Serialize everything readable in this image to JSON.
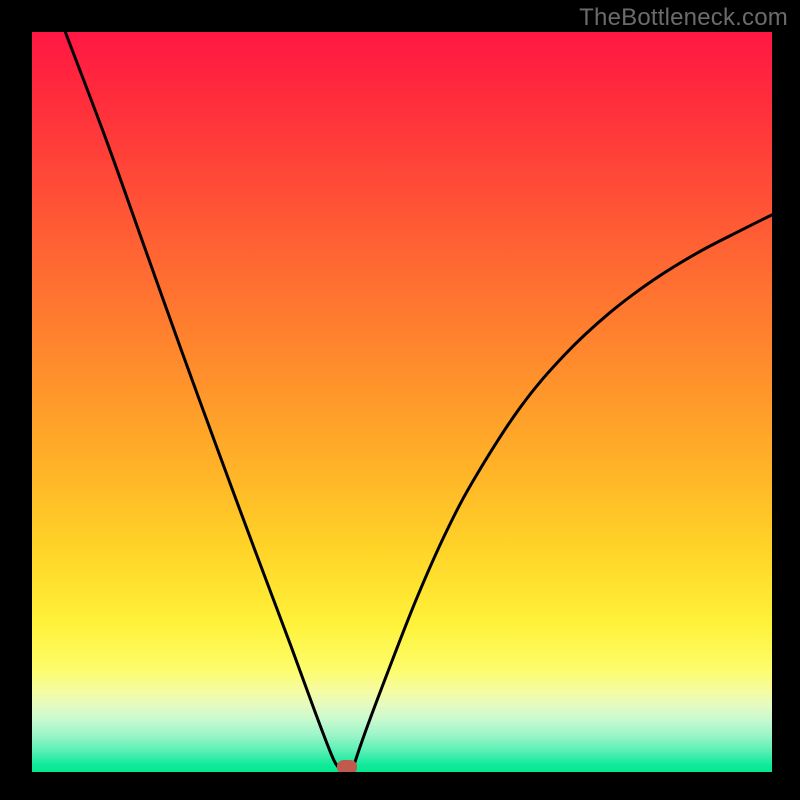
{
  "watermark": "TheBottleneck.com",
  "colors": {
    "background": "#000000",
    "curve": "#000000",
    "marker": "#c05a4e"
  },
  "chart_data": {
    "type": "line",
    "title": "",
    "xlabel": "",
    "ylabel": "",
    "xlim": [
      0,
      100
    ],
    "ylim": [
      0,
      100
    ],
    "grid": false,
    "legend": false,
    "curve_left": {
      "x": [
        4.5,
        10,
        15,
        20,
        25,
        30,
        35,
        38,
        40,
        41,
        42
      ],
      "y": [
        100,
        85.5,
        71.5,
        57.5,
        43.8,
        30.3,
        17.0,
        8.8,
        3.5,
        1.2,
        0
      ]
    },
    "curve_right": {
      "x": [
        43.2,
        45,
        48,
        52,
        56,
        60,
        66,
        72,
        78,
        84,
        90,
        96,
        100
      ],
      "y": [
        0,
        5.3,
        13.3,
        23.5,
        32.5,
        40.0,
        49.3,
        56.4,
        62.0,
        66.5,
        70.2,
        73.3,
        75.3
      ]
    },
    "minimum_marker": {
      "x": 42.5,
      "y": 0
    },
    "gradient_description": "vertical spectral gradient from red (top) through orange, yellow, to green (bottom)"
  }
}
